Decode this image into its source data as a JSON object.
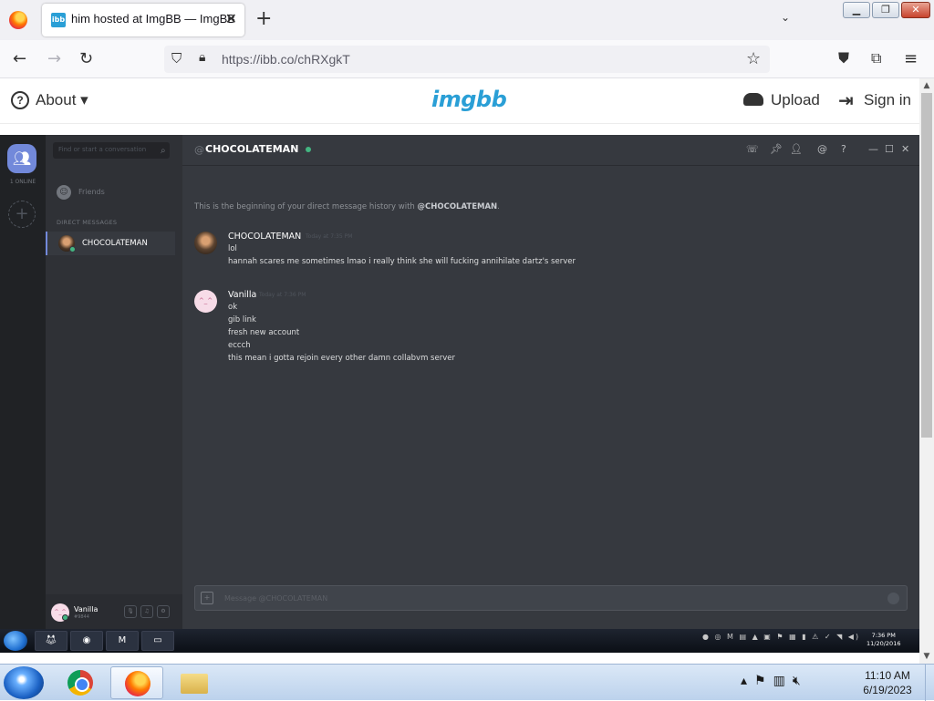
{
  "browser": {
    "tab_title": "him hosted at ImgBB — ImgBB",
    "tab_favicon_text": "ibb",
    "url_prefix": "https://",
    "url_host": "ibb.co",
    "url_path": "/chRXgkT"
  },
  "imgbb": {
    "about_label": "About",
    "logo_text": "imgbb",
    "upload_label": "Upload",
    "signin_label": "Sign in"
  },
  "discord": {
    "search_placeholder": "Find or start a conversation",
    "online_count": "1 ONLINE",
    "friends_label": "Friends",
    "dm_header": "DIRECT MESSAGES",
    "dm_item_name": "CHOCOLATEMAN",
    "chat_at": "@",
    "chat_name": "CHOCOLATEMAN",
    "beginning_text": "This is the beginning of your direct message history with ",
    "beginning_name": "@CHOCOLATEMAN",
    "beginning_end": ".",
    "messages": [
      {
        "author": "CHOCOLATEMAN",
        "time": "Today at 7:35 PM",
        "lines": [
          "lol",
          "hannah scares me sometimes lmao i really think she will fucking annihilate dartz's server"
        ]
      },
      {
        "author": "Vanilla",
        "time": "Today at 7:36 PM",
        "lines": [
          "ok",
          "gib link",
          "fresh new account",
          "eccch",
          "this mean i gotta rejoin every other damn collabvm server"
        ]
      }
    ],
    "composer_placeholder": "Message @CHOCOLATEMAN",
    "user_name": "Vanilla",
    "user_tag": "#9844",
    "inner_clock_time": "7:36 PM",
    "inner_clock_date": "11/20/2016"
  },
  "taskbar": {
    "time": "11:10 AM",
    "date": "6/19/2023"
  },
  "colors": {
    "imgbb_brand": "#2a9fd6",
    "discord_bg": "#36393f",
    "discord_blurple": "#7289da",
    "online_green": "#43b581"
  }
}
